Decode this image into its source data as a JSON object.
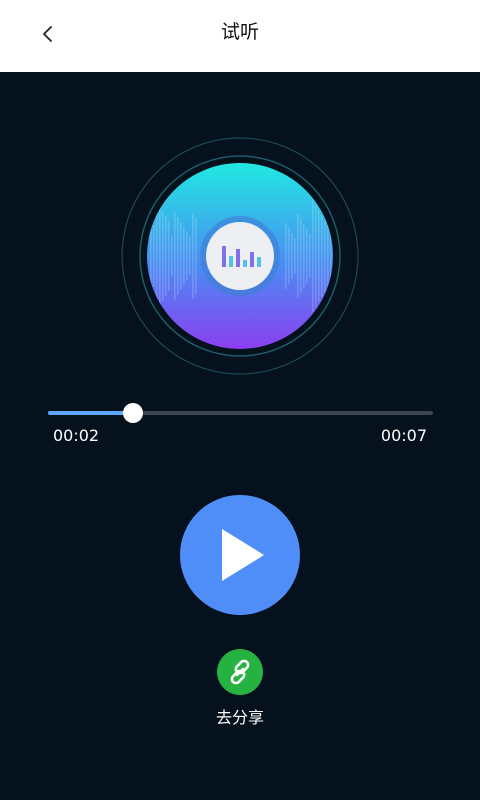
{
  "header": {
    "title": "试听",
    "back_icon": "chevron-left-icon"
  },
  "player": {
    "current_time": "00:02",
    "total_time": "00:07",
    "progress": 0.22,
    "play_icon": "play-icon",
    "disc_icon": "equalizer-icon"
  },
  "share": {
    "label": "去分享",
    "icon": "link-icon"
  },
  "colors": {
    "background": "#05111c",
    "accent_blue": "#4f8ef8",
    "progress_fill": "#5aa8ff",
    "share_green": "#25b240",
    "disc_top": "#21e8e0",
    "disc_bottom": "#8b3ff0"
  }
}
